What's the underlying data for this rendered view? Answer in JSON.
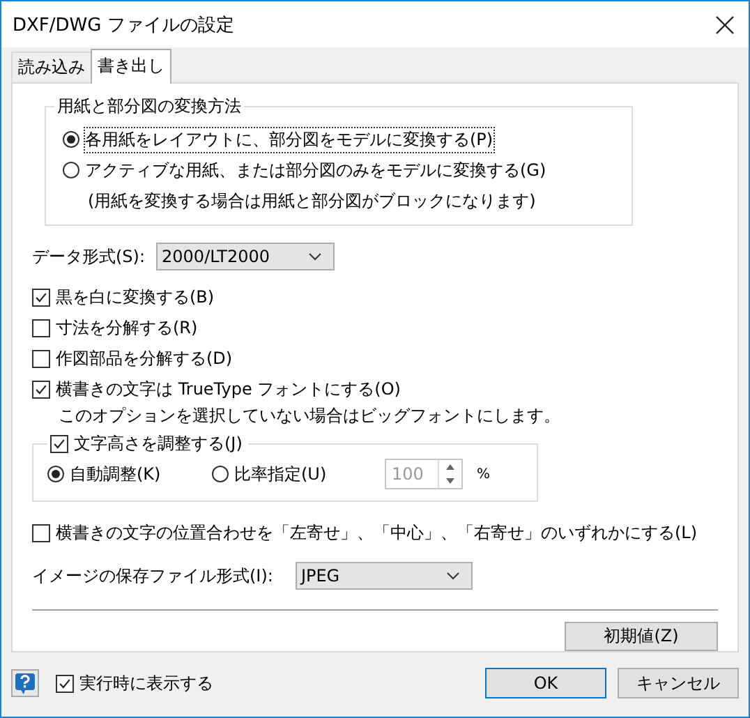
{
  "window": {
    "title": "DXF/DWG ファイルの設定"
  },
  "tabs": [
    {
      "label": "読み込み",
      "selected": false
    },
    {
      "label": "書き出し",
      "selected": true
    }
  ],
  "conversion": {
    "title": "用紙と部分図の変換方法",
    "options": [
      {
        "label": "各用紙をレイアウトに、部分図をモデルに変換する(P)",
        "selected": true,
        "focused": true
      },
      {
        "label": "アクティブな用紙、または部分図のみをモデルに変換する(G)",
        "selected": false,
        "focused": false
      }
    ],
    "note": "(用紙を変換する場合は用紙と部分図がブロックになります)"
  },
  "data_format": {
    "label": "データ形式(S):",
    "value": "2000/LT2000"
  },
  "checkboxes": [
    {
      "label": "黒を白に変換する(B)",
      "checked": true
    },
    {
      "label": "寸法を分解する(R)",
      "checked": false
    },
    {
      "label": "作図部品を分解する(D)",
      "checked": false
    },
    {
      "label": "横書きの文字は TrueType フォントにする(O)",
      "checked": true,
      "note": "このオプションを選択していない場合はビッグフォントにします。"
    }
  ],
  "text_height": {
    "label": "文字高さを調整する(J)",
    "checked": true,
    "options": [
      {
        "label": "自動調整(K)",
        "selected": true
      },
      {
        "label": "比率指定(U)",
        "selected": false
      }
    ],
    "ratio": {
      "value": "100",
      "disabled": true,
      "unit": "%"
    }
  },
  "align": {
    "label": "横書きの文字の位置合わせを「左寄せ」、「中心」、「右寄せ」のいずれかにする(L)",
    "checked": false
  },
  "image_format": {
    "label": "イメージの保存ファイル形式(I):",
    "value": "JPEG"
  },
  "default_button": "初期値(Z)",
  "footer": {
    "show_on_start": {
      "label": "実行時に表示する",
      "checked": true
    },
    "buttons": [
      {
        "label": "OK",
        "kind": "default"
      },
      {
        "label": "キャンセル",
        "kind": "normal"
      }
    ]
  }
}
